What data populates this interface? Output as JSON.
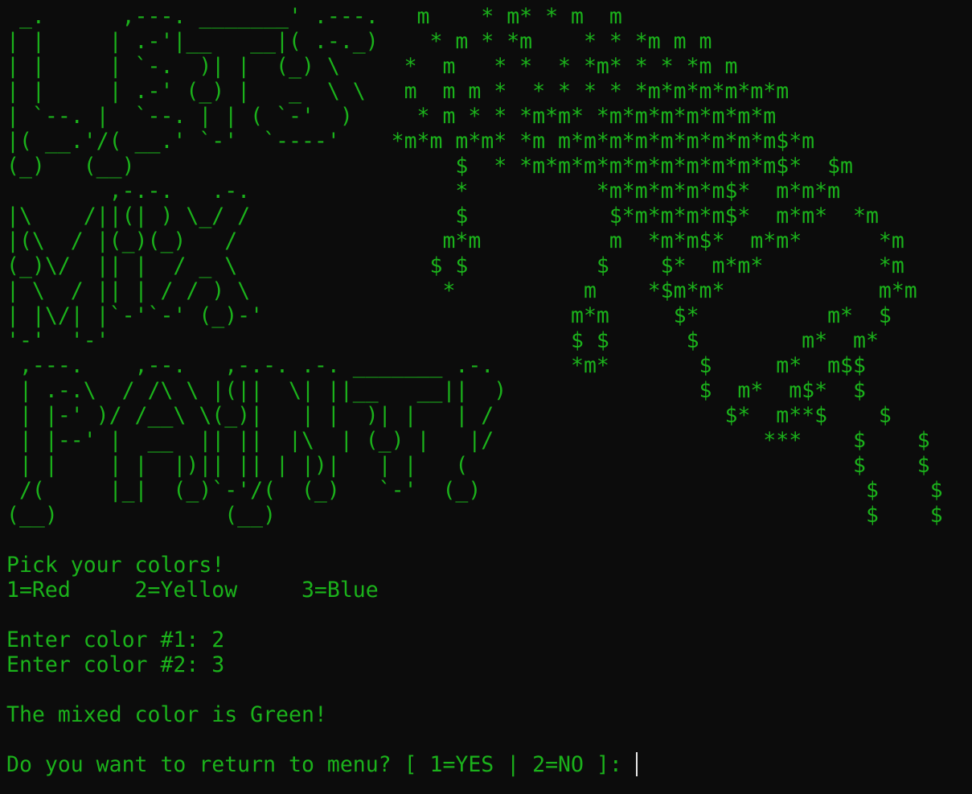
{
  "terminal": {
    "colors": {
      "background": "#0c0c0c",
      "text": "#1bb21b",
      "cursor": "#e6e6e6"
    },
    "art_lines": [
      " _.      ,---. _______' .---.   m    * m* * m  m",
      "| |     | .-'|__   __|( .-._)    * m * *m    * * *m m m",
      "| |     | `-.  )| |  (_) \\     *  m   * *  * *m* * * *m m",
      "| |     | .-' (_) |   _  \\ \\   m  m m *  * * * * *m*m*m*m*m*m",
      "| `--. |  `--. | | ( `-'  )     * m * * *m*m* *m*m*m*m*m*m*m",
      "|( __.'/( __.' `-'  `----'    *m*m m*m* *m m*m*m*m*m*m*m*m*m$*m",
      "(_)   (__)                         $  * *m*m*m*m*m*m*m*m*m*m$*  $m",
      "        ,-.-.   .-.                *          *m*m*m*m*m$*  m*m*m",
      "|\\    /||(| ) \\_/ /                $           $*m*m*m*m$*  m*m*  *m",
      "|(\\  / |(_)(_)   /                m*m          m  *m*m$*  m*m*      *m",
      "(_)\\/  || |  / _ \\               $ $          $    $*  m*m*         *m",
      "| \\  / || | / / ) \\               *          m    *$m*m*            m*m",
      "| |\\/| |`-'`-' (_)-'                        m*m     $*          m*  $",
      "'-'  '-'                                    $ $      $        m*  m*",
      " ,---.    ,--.   ,-.-. .-. _______ .-.      *m*       $     m*  m$$",
      " | .-.\\  / /\\ \\ |(||  \\| ||__   __||  )               $  m*  m$*  $",
      " | |-' )/ /__\\ \\(_)|   | |  )| |   | /                  $*  m**$    $",
      " | |--' |  __  || ||  |\\  | (_) |   |/                     ***    $    $",
      " | |    | |  |)|| || | |)|   | |   (                              $    $",
      " /(     |_|  (_)`-'/(  (_)   `-'  (_)                              $    $",
      "(__)             (__)                                              $    $"
    ],
    "prompt_title": "Pick your colors!",
    "options_line": "1=Red     2=Yellow     3=Blue",
    "input_1": "Enter color #1: 2",
    "input_2": "Enter color #2: 3",
    "result": "The mixed color is Green!",
    "menu_prompt": "Do you want to return to menu? [ 1=YES | 2=NO ]: "
  }
}
